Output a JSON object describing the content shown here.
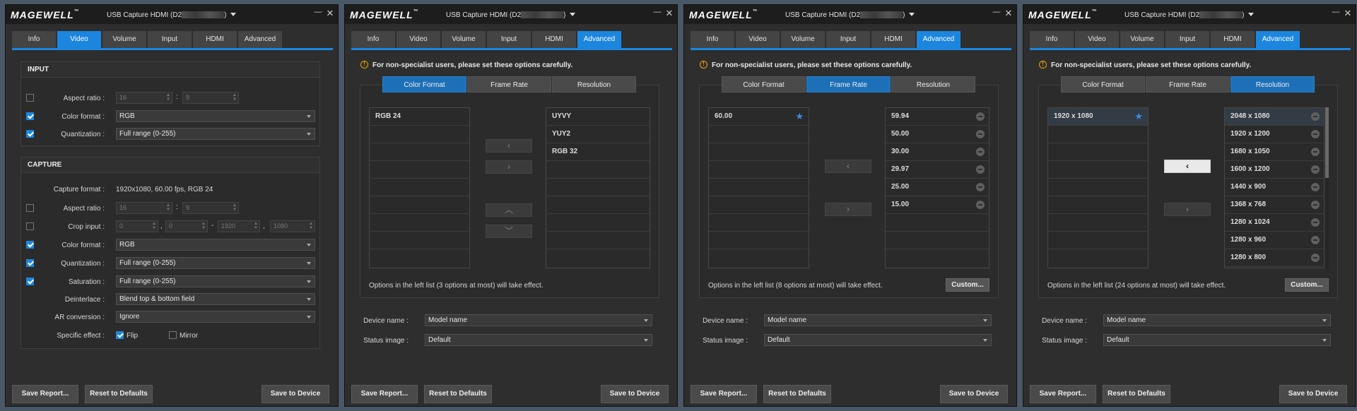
{
  "app": {
    "logo": "MAGEWELL",
    "device_prefix": "USB Capture HDMI (D2",
    "device_suffix": ")",
    "tabs": [
      "Info",
      "Video",
      "Volume",
      "Input",
      "HDMI",
      "Advanced"
    ]
  },
  "video": {
    "input_title": "INPUT",
    "input": {
      "aspect_label": "Aspect ratio :",
      "aspect_w": "16",
      "aspect_h": "9",
      "color_label": "Color format :",
      "color_value": "RGB",
      "quant_label": "Quantization :",
      "quant_value": "Full range (0-255)"
    },
    "capture_title": "CAPTURE",
    "capture": {
      "format_label": "Capture format :",
      "format_value": "1920x1080, 60.00 fps, RGB 24",
      "aspect_label": "Aspect ratio :",
      "aspect_w": "16",
      "aspect_h": "9",
      "crop_label": "Crop input :",
      "crop_x": "0",
      "crop_y": "0",
      "crop_w": "1920",
      "crop_h": "1080",
      "color_label": "Color format :",
      "color_value": "RGB",
      "quant_label": "Quantization :",
      "quant_value": "Full range (0-255)",
      "sat_label": "Saturation :",
      "sat_value": "Full range (0-255)",
      "deint_label": "Deinterlace :",
      "deint_value": "Blend top & bottom field",
      "ar_label": "AR conversion :",
      "ar_value": "Ignore",
      "effect_label": "Specific effect :",
      "flip_label": "Flip",
      "mirror_label": "Mirror"
    }
  },
  "advanced": {
    "warning": "For non-specialist users, please set these options carefully.",
    "subtabs": [
      "Color Format",
      "Frame Rate",
      "Resolution"
    ],
    "custom_label": "Custom...",
    "device_name_label": "Device name :",
    "device_name_value": "Model name",
    "status_image_label": "Status image :",
    "status_image_value": "Default",
    "color": {
      "left": [
        "RGB 24"
      ],
      "right": [
        "UYVY",
        "YUY2",
        "RGB 32"
      ],
      "note": "Options in the left list (3 options at most) will take effect."
    },
    "framerate": {
      "left": [
        "60.00"
      ],
      "right": [
        "59.94",
        "50.00",
        "30.00",
        "29.97",
        "25.00",
        "15.00"
      ],
      "note": "Options in the left list (8 options at most) will take effect."
    },
    "resolution": {
      "left": [
        "1920 x 1080"
      ],
      "right": [
        "2048 x 1080",
        "1920 x 1200",
        "1680 x 1050",
        "1600 x 1200",
        "1440 x 900",
        "1368 x 768",
        "1280 x 1024",
        "1280 x 960",
        "1280 x 800"
      ],
      "note": "Options in the left list (24 options at most) will take effect."
    }
  },
  "footer": {
    "save_report": "Save Report...",
    "reset": "Reset to Defaults",
    "save_device": "Save to Device"
  },
  "icons": {
    "star": "star-icon",
    "minus": "remove-icon",
    "warning": "warning-icon"
  },
  "colors": {
    "accent": "#1c86df",
    "warning": "#f0a500"
  }
}
